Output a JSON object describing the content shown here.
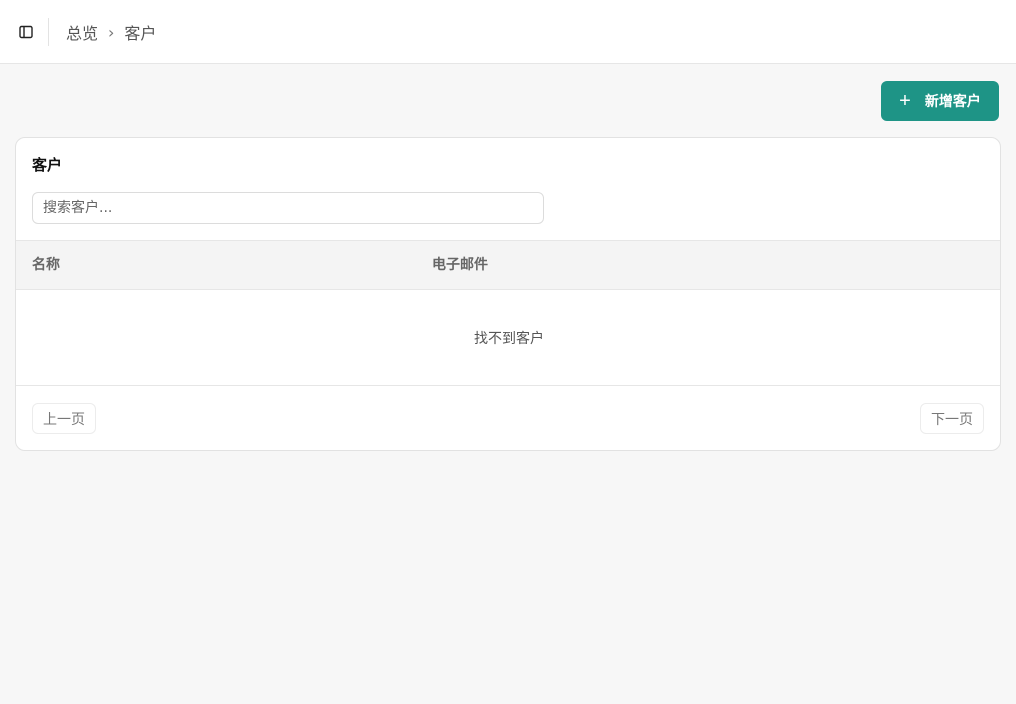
{
  "header": {
    "sidebar_toggle_icon": "sidebar-toggle-icon",
    "breadcrumb": {
      "parent": "总览",
      "separator": "›",
      "current": "客户"
    }
  },
  "actions": {
    "add_customer_label": "新增客户",
    "add_icon": "plus-icon"
  },
  "card": {
    "title": "客户",
    "search_placeholder": "搜索客户...",
    "columns": [
      "名称",
      "电子邮件"
    ],
    "empty_message": "找不到客户",
    "pagination": {
      "prev_label": "上一页",
      "next_label": "下一页"
    }
  },
  "colors": {
    "accent": "#1e9486",
    "background": "#f7f7f7"
  }
}
